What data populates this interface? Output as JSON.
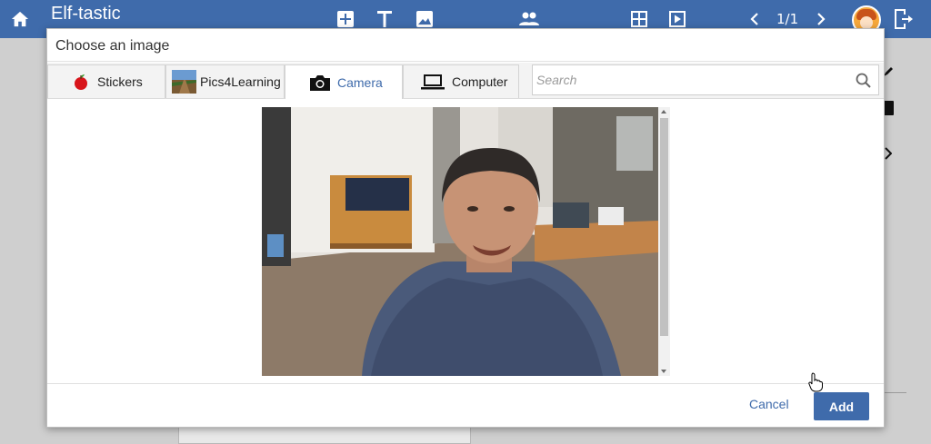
{
  "app": {
    "title": "Elf-tastic",
    "page_counter": "1/1"
  },
  "toolbar_icons": [
    "home-icon",
    "add-icon",
    "text-icon",
    "image-icon",
    "collaborators-icon",
    "layout-icon",
    "play-icon",
    "prev-page-icon",
    "next-page-icon",
    "exit-icon"
  ],
  "modal": {
    "title": "Choose an image",
    "tabs": [
      {
        "label": "Stickers",
        "icon": "apple-icon",
        "active": false
      },
      {
        "label": "Pics4Learning",
        "icon": "landscape-thumbnail-icon",
        "active": false
      },
      {
        "label": "Camera",
        "icon": "camera-icon",
        "active": true
      },
      {
        "label": "Computer",
        "icon": "laptop-icon",
        "active": false
      }
    ],
    "search": {
      "placeholder": "Search",
      "value": ""
    },
    "cancel_label": "Cancel",
    "add_label": "Add"
  },
  "colors": {
    "topbar": "#3f6bab",
    "accent": "#3f6bab",
    "active_tab_text": "#3f6bab"
  }
}
